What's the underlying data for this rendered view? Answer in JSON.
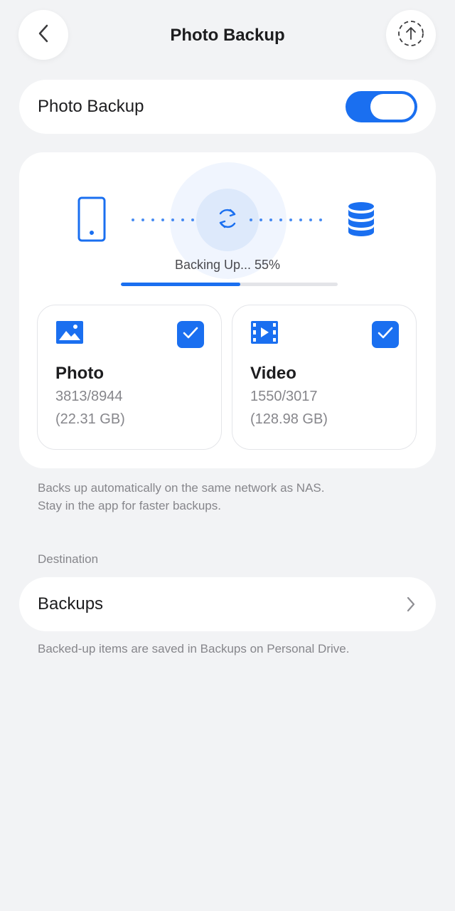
{
  "header": {
    "title": "Photo Backup",
    "back_icon": "chevron-left-icon",
    "upload_icon": "upload-arrow-icon"
  },
  "toggle_row": {
    "label": "Photo Backup",
    "enabled": true
  },
  "backup_status": {
    "text": "Backing Up... 55%",
    "progress": 0.55,
    "source_icon": "phone-icon",
    "sync_icon": "sync-icon",
    "target_icon": "database-icon"
  },
  "media": {
    "photo": {
      "title": "Photo",
      "count": "3813/8944",
      "size": "(22.31 GB)",
      "checked": true,
      "icon": "image-icon"
    },
    "video": {
      "title": "Video",
      "count": "1550/3017",
      "size": "(128.98 GB)",
      "checked": true,
      "icon": "film-icon"
    }
  },
  "info": {
    "line1": "Backs up automatically on the same network as NAS.",
    "line2": "Stay in the app for faster backups."
  },
  "destination": {
    "section_label": "Destination",
    "value": "Backups",
    "footer": "Backed-up items are saved in Backups on Personal Drive."
  },
  "colors": {
    "accent": "#1a6ff0",
    "background": "#f2f3f5",
    "card": "#ffffff",
    "secondary_text": "#86868b"
  }
}
